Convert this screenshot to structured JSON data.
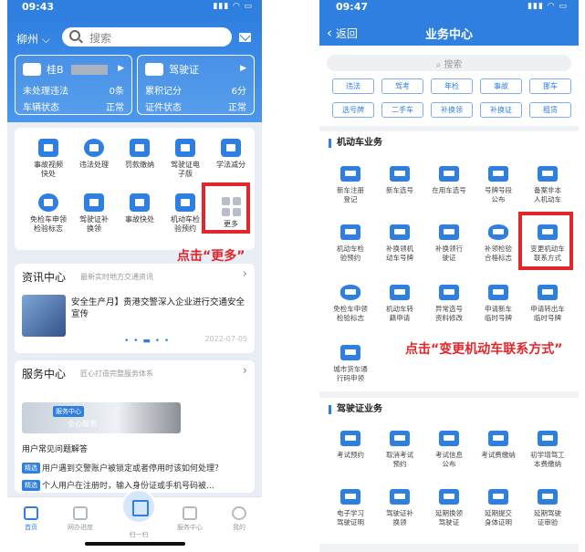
{
  "left": {
    "status_time": "09:43",
    "city": "柳州",
    "search_placeholder": "搜索",
    "vehicle_card": {
      "plate": "桂B",
      "row1_label": "未处理违法",
      "row1_value": "0条",
      "row2_label": "车辆状态",
      "row2_value": "正常"
    },
    "license_card": {
      "title": "驾驶证",
      "row1_label": "累积记分",
      "row1_value": "6分",
      "row2_label": "证件状态",
      "row2_value": "正常"
    },
    "menu": [
      "事故视频\n快处",
      "违法处理",
      "罚款缴纳",
      "驾驶证电\n子版",
      "学法减分",
      "免检车申领\n检验标志",
      "驾驶证补\n换领",
      "事故快处",
      "机动车检\n验预约",
      "更多"
    ],
    "callout_more": "点击“更多”",
    "news": {
      "title": "资讯中心",
      "subtitle": "最新实时地方交通资讯",
      "headline": "安全生产月】贵港交警深入企业进行交通安全宣传",
      "date": "2022-07-05"
    },
    "service": {
      "title": "服务中心",
      "subtitle": "匠心打造完整服务体系",
      "banner_tag": "服务中心",
      "banner_text": "全心服务",
      "faq_title": "用户常见问题解答",
      "faq": [
        {
          "tag": "精选",
          "text": "用户遇到交警账户被锁定或者停用时该如何处理？"
        },
        {
          "tag": "精选",
          "text": "个人用户在注册时，输入身份证或手机号码被..."
        }
      ]
    },
    "tabs": [
      "首页",
      "网办进度",
      "扫一扫",
      "服务中心",
      "我的"
    ]
  },
  "right": {
    "status_time": "09:47",
    "back_label": "返回",
    "title": "业务中心",
    "search_placeholder": "搜索",
    "chips": [
      "违法",
      "驾考",
      "年检",
      "事故",
      "挪车",
      "选号牌",
      "二手车",
      "补换领",
      "补换证",
      "租赁"
    ],
    "vehicle_section": {
      "title": "机动车业务",
      "items": [
        "新车注册\n登记",
        "新车选号",
        "在用车选号",
        "号牌号段\n公布",
        "备案非本\n人机动车",
        "机动车检\n验预约",
        "补换领机\n动车号牌",
        "补换领行\n驶证",
        "补领检验\n合格标志",
        "变更机动车\n联系方式",
        "免检车申领\n检验标志",
        "机动车转\n籍申请",
        "异常选号\n资料修改",
        "申请新车\n临时号牌",
        "申请转出车\n临时号牌",
        "城市货车通\n行码申领"
      ]
    },
    "callout_change": "点击“变更机动车联系方式”",
    "license_section": {
      "title": "驾驶证业务",
      "items": [
        "考试预约",
        "取消考试\n预约",
        "考试信息\n公布",
        "考试费缴纳",
        "初学增驾工\n本费缴纳",
        "电子学习\n驾驶证明",
        "驾驶证补\n换领",
        "延期换领\n驾驶证",
        "延期提交\n身体证明",
        "延期驾驶\n证审验"
      ]
    }
  }
}
